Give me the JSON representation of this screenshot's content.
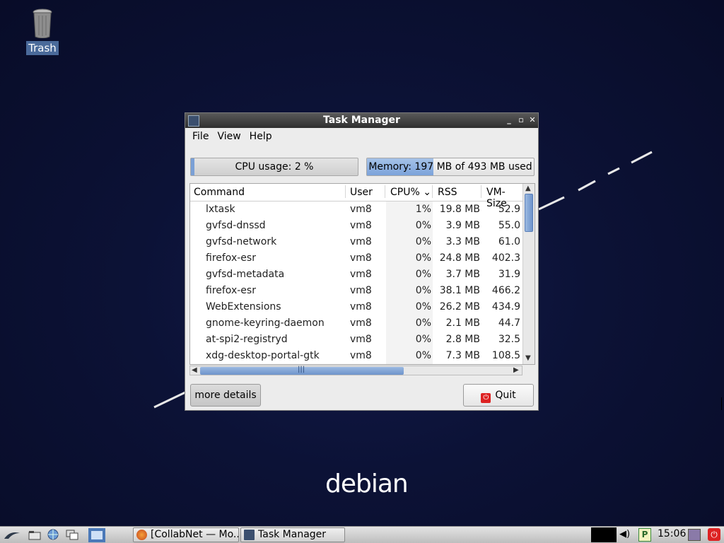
{
  "desktop": {
    "trash_label": "Trash",
    "logo_text": "debian"
  },
  "window": {
    "title": "Task Manager",
    "menu": [
      "File",
      "View",
      "Help"
    ],
    "cpu_usage_text": "CPU usage: 2 %",
    "cpu_usage_fraction": 0.02,
    "memory_text": "Memory: 197 MB of 493 MB used",
    "memory_fraction": 0.4,
    "columns": [
      "Command",
      "User",
      "CPU%",
      "RSS",
      "VM-Size"
    ],
    "processes": [
      {
        "command": "lxtask",
        "user": "vm8",
        "cpu": "1%",
        "rss": "19.8 MB",
        "vm": "52.9"
      },
      {
        "command": "gvfsd-dnssd",
        "user": "vm8",
        "cpu": "0%",
        "rss": "3.9 MB",
        "vm": "55.0"
      },
      {
        "command": "gvfsd-network",
        "user": "vm8",
        "cpu": "0%",
        "rss": "3.3 MB",
        "vm": "61.0"
      },
      {
        "command": "firefox-esr",
        "user": "vm8",
        "cpu": "0%",
        "rss": "24.8 MB",
        "vm": "402.3"
      },
      {
        "command": "gvfsd-metadata",
        "user": "vm8",
        "cpu": "0%",
        "rss": "3.7 MB",
        "vm": "31.9"
      },
      {
        "command": "firefox-esr",
        "user": "vm8",
        "cpu": "0%",
        "rss": "38.1 MB",
        "vm": "466.2"
      },
      {
        "command": "WebExtensions",
        "user": "vm8",
        "cpu": "0%",
        "rss": "26.2 MB",
        "vm": "434.9"
      },
      {
        "command": "gnome-keyring-daemon",
        "user": "vm8",
        "cpu": "0%",
        "rss": "2.1 MB",
        "vm": "44.7"
      },
      {
        "command": "at-spi2-registryd",
        "user": "vm8",
        "cpu": "0%",
        "rss": "2.8 MB",
        "vm": "32.5"
      },
      {
        "command": "xdg-desktop-portal-gtk",
        "user": "vm8",
        "cpu": "0%",
        "rss": "7.3 MB",
        "vm": "108.5"
      }
    ],
    "more_details_label": "more details",
    "quit_label": "Quit"
  },
  "taskbar": {
    "tasks": [
      "[CollabNet — Mo...",
      "Task Manager"
    ],
    "clock": "15:06"
  }
}
